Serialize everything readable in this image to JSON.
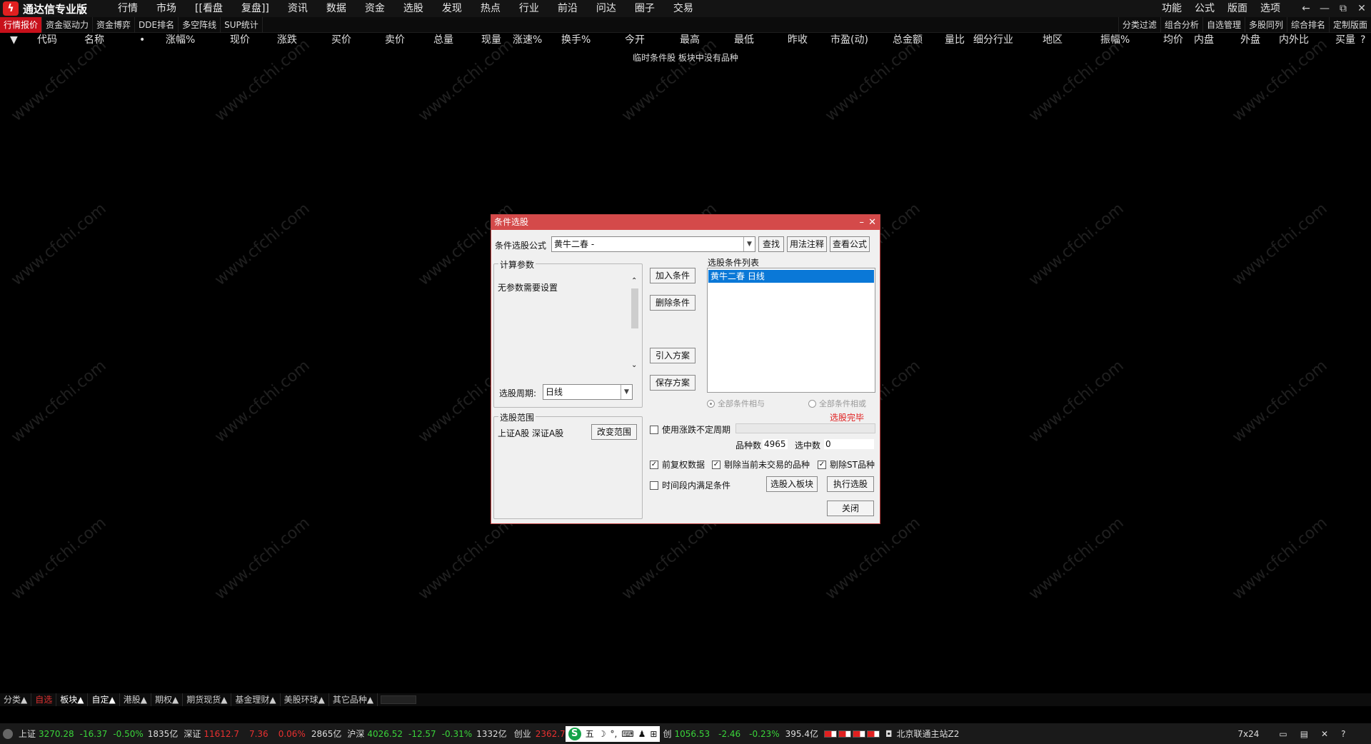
{
  "app": {
    "title": "通达信专业版",
    "logo_glyph": "ϟ"
  },
  "menu": [
    "行情",
    "市场",
    "[[看盘",
    "复盘]]",
    "资讯",
    "数据",
    "资金",
    "选股",
    "发现",
    "热点",
    "行业",
    "前沿",
    "问达",
    "圈子",
    "交易"
  ],
  "right_menu": [
    "功能",
    "公式",
    "版面",
    "选项"
  ],
  "window_controls": [
    "←",
    "—",
    "⧉",
    "✕"
  ],
  "tabs_left": [
    "行情报价",
    "资金驱动力",
    "资金博弈",
    "DDE排名",
    "多空阵线",
    "SUP统计"
  ],
  "tabs_right": [
    "分类过滤",
    "组合分析",
    "自选管理",
    "多股同列",
    "综合排名",
    "定制版面"
  ],
  "columns": [
    "▼",
    "代码",
    "名称",
    "•",
    "涨幅%",
    "现价",
    "涨跌",
    "买价",
    "卖价",
    "总量",
    "现量",
    "涨速%",
    "换手%",
    "今开",
    "最高",
    "最低",
    "昨收",
    "市盈(动)",
    "总金额",
    "量比",
    "细分行业",
    "地区",
    "振幅%",
    "均价",
    "内盘",
    "外盘",
    "内外比",
    "买量",
    "?"
  ],
  "empty_message": "临时条件股 板块中没有品种",
  "watermark": "www.cfchi.com",
  "dialog": {
    "title": "条件选股",
    "formula_label": "条件选股公式",
    "formula_value": "黄牛二春     -",
    "btn_find": "查找",
    "btn_usage": "用法注释",
    "btn_view": "查看公式",
    "params_group": "计算参数",
    "params_text": "无参数需要设置",
    "period_label": "选股周期:",
    "period_value": "日线",
    "btn_add": "加入条件",
    "btn_delete": "删除条件",
    "btn_import": "引入方案",
    "btn_save": "保存方案",
    "conditions_label": "选股条件列表",
    "conditions": [
      "黄牛二春  日线"
    ],
    "radio_and": "全部条件相与",
    "radio_or": "全部条件相或",
    "status": "选股完毕",
    "range_group": "选股范围",
    "range_text": "上证A股 深证A股",
    "btn_change_range": "改变范围",
    "chk_variable_period": "使用涨跌不定周期",
    "count_label": "品种数",
    "count_value": "4965",
    "selected_label": "选中数",
    "selected_value": "0",
    "chk_prev_adjust": "前复权数据",
    "chk_remove_untraded": "剔除当前未交易的品种",
    "chk_remove_st": "剔除ST品种",
    "chk_time_range": "时间段内满足条件",
    "btn_to_block": "选股入板块",
    "btn_execute": "执行选股",
    "btn_close": "关闭"
  },
  "bottom_tabs": [
    {
      "label": "分类▲",
      "style": "w"
    },
    {
      "label": "自选",
      "style": "red"
    },
    {
      "label": "板块▲",
      "style": "white"
    },
    {
      "label": "自定▲",
      "style": "white"
    },
    {
      "label": "港股▲",
      "style": "w"
    },
    {
      "label": "期权▲",
      "style": "w"
    },
    {
      "label": "期货现货▲",
      "style": "w"
    },
    {
      "label": "基金理财▲",
      "style": "w"
    },
    {
      "label": "美股环球▲",
      "style": "w"
    },
    {
      "label": "其它品种▲",
      "style": "w"
    }
  ],
  "status_bar": {
    "sh_label": "上证",
    "sh_value": "3270.28",
    "sh_change": "-16.37",
    "sh_pct": "-0.50%",
    "sh_amount": "1835亿",
    "sz_label": "深证",
    "sz_value": "11612.7",
    "sz_change": "7.36",
    "sz_pct": "0.06%",
    "sz_amount": "2865亿",
    "hs_label": "沪深",
    "hs_value": "4026.52",
    "hs_change": "-12.57",
    "hs_pct": "-0.31%",
    "hs_amount": "1332亿",
    "cy_label": "创业",
    "cy_value": "2362.7",
    "ime_text": "五",
    "kc_label": "创",
    "kc_value": "1056.53",
    "kc_change": "-2.46",
    "kc_pct": "-0.23%",
    "kc_amount": "395.4亿",
    "server": "北京联通主站Z2",
    "clock_label": "7x24"
  }
}
